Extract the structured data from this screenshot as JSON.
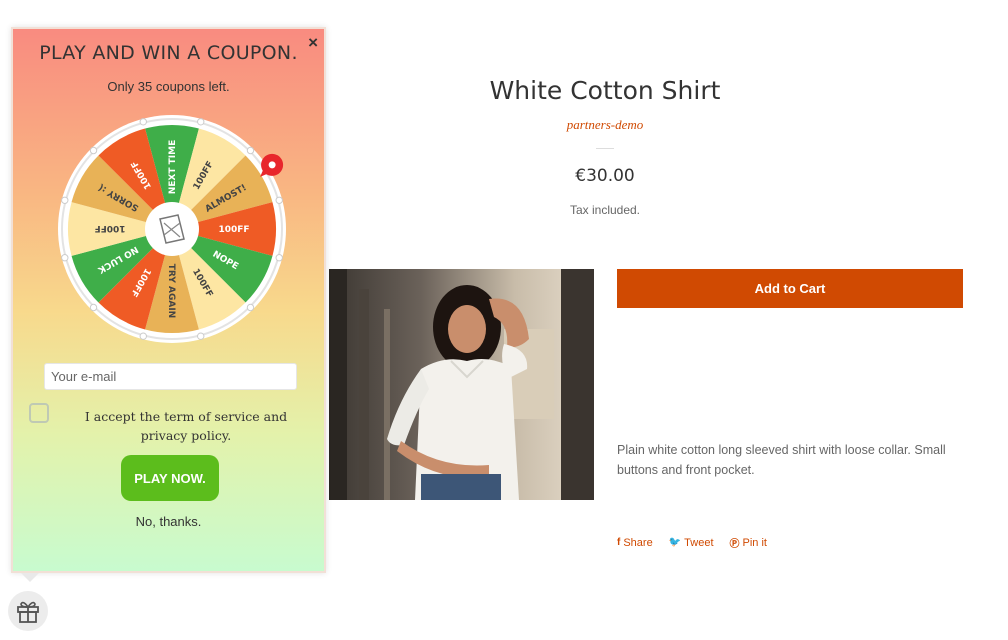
{
  "product": {
    "title": "White Cotton Shirt",
    "vendor": "partners-demo",
    "price": "€30.00",
    "tax_note": "Tax included.",
    "add_to_cart_label": "Add to Cart",
    "description": "Plain white cotton long sleeved shirt with loose collar. Small buttons and front pocket.",
    "share": [
      {
        "icon": "facebook-icon",
        "label": "Share"
      },
      {
        "icon": "twitter-icon",
        "label": "Tweet"
      },
      {
        "icon": "pinterest-icon",
        "label": "Pin it"
      }
    ],
    "image_alt": "Woman wearing white cotton shirt"
  },
  "popup": {
    "title": "PLAY AND WIN A COUPON.",
    "subtitle": "Only 35 coupons left.",
    "close_label": "×",
    "email_placeholder": "Your e-mail",
    "terms_text": "I accept the term of service and privacy policy.",
    "play_label": "PLAY NOW.",
    "no_thanks_label": "No, thanks.",
    "wheel_segments": [
      "NEXT TIME",
      "100FF",
      "ALMOST!",
      "100FF",
      "NOPE",
      "100FF",
      "TRY AGAIN",
      "100FF",
      "NO LUCK",
      "100FF",
      "SORRY :(",
      "100FF"
    ]
  },
  "colors": {
    "accent": "#d04a02",
    "play_button": "#5cbd1c",
    "wheel_green": "#3fae49",
    "wheel_orange": "#ef5b25",
    "wheel_sand": "#e8b257",
    "wheel_cream": "#fde6a3",
    "pointer_red": "#e8262c"
  }
}
